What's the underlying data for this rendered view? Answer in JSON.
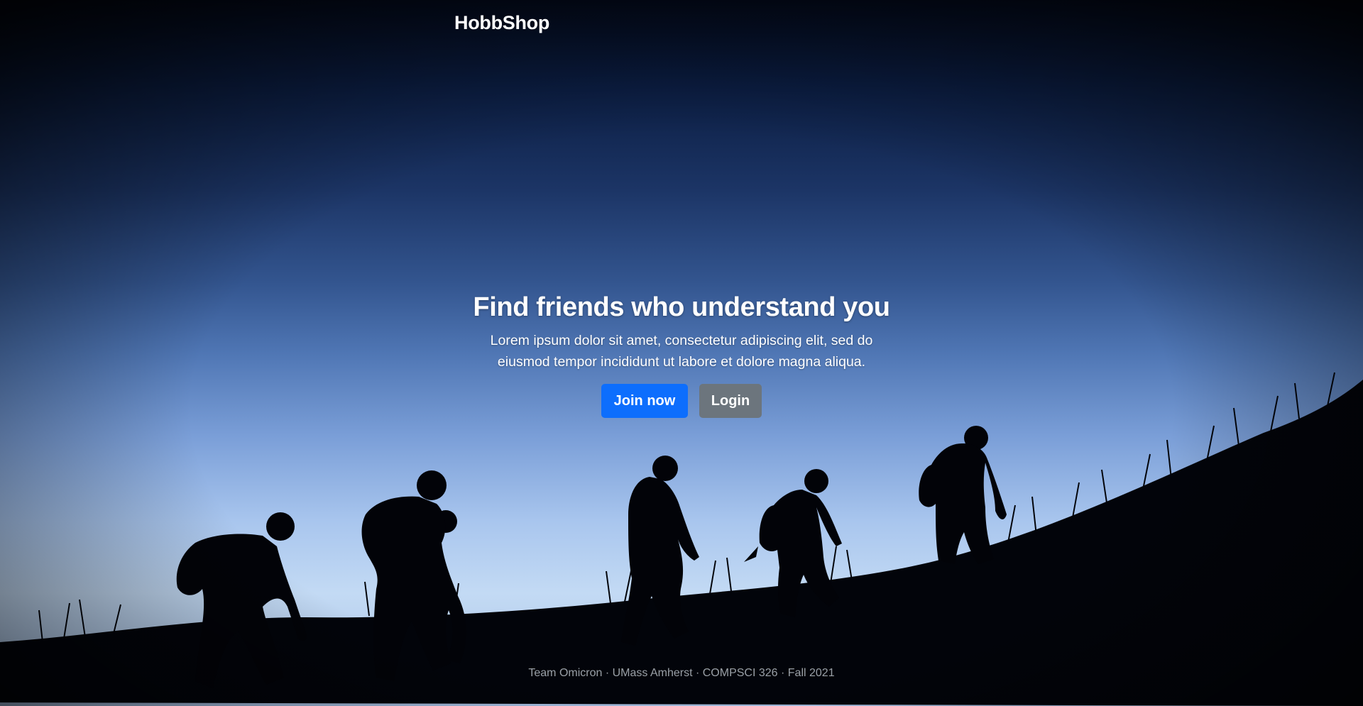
{
  "navbar": {
    "brand": "HobbShop"
  },
  "hero": {
    "title": "Find friends who understand you",
    "text": "Lorem ipsum dolor sit amet, consectetur adipiscing elit, sed do eiusmod tempor incididunt ut labore et dolore magna aliqua.",
    "join_label": "Join now",
    "login_label": "Login"
  },
  "footer": {
    "text": "Team Omicron · UMass Amherst · COMPSCI 326 · Fall 2021"
  },
  "colors": {
    "primary_button": "#0d6efd",
    "secondary_button": "#6c757d",
    "text": "#ffffff",
    "footer_text": "#9aa0a6"
  }
}
